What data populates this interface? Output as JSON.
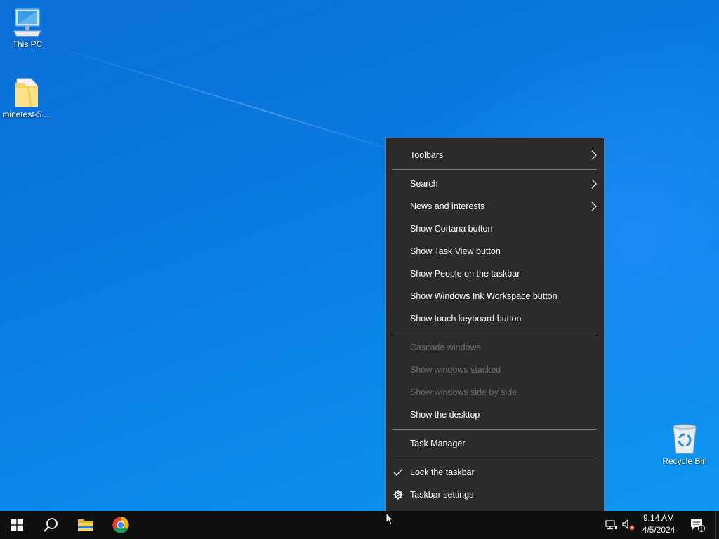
{
  "desktop": {
    "icons": [
      {
        "label": "This PC",
        "icon": "computer-icon"
      },
      {
        "label": "minetest-5....",
        "icon": "folder-icon"
      },
      {
        "label": "Recycle Bin",
        "icon": "recycle-bin-icon"
      }
    ]
  },
  "context_menu": {
    "items": [
      {
        "label": "Toolbars",
        "submenu": true
      },
      {
        "label": "Search",
        "submenu": true
      },
      {
        "label": "News and interests",
        "submenu": true
      },
      {
        "label": "Show Cortana button"
      },
      {
        "label": "Show Task View button"
      },
      {
        "label": "Show People on the taskbar"
      },
      {
        "label": "Show Windows Ink Workspace button"
      },
      {
        "label": "Show touch keyboard button"
      },
      {
        "label": "Cascade windows",
        "disabled": true
      },
      {
        "label": "Show windows stacked",
        "disabled": true
      },
      {
        "label": "Show windows side by side",
        "disabled": true
      },
      {
        "label": "Show the desktop"
      },
      {
        "label": "Task Manager"
      },
      {
        "label": "Lock the taskbar",
        "checked": true
      },
      {
        "label": "Taskbar settings",
        "icon": "gear-icon"
      }
    ]
  },
  "taskbar": {
    "apps": [
      "start-icon",
      "search-icon",
      "file-explorer-icon",
      "chrome-icon"
    ],
    "tray": {
      "time": "9:14 AM",
      "date": "4/5/2024",
      "notification_count": "1"
    }
  },
  "colors": {
    "desktop_blue": "#0a78e0",
    "menu_bg": "#2b2b2b",
    "taskbar_bg": "#101010"
  }
}
